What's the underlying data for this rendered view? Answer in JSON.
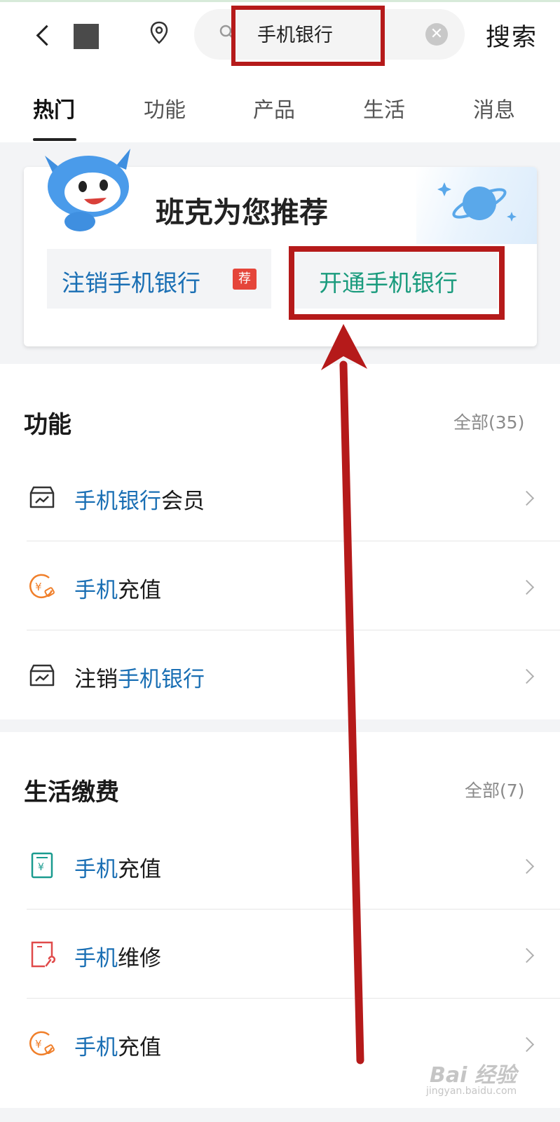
{
  "header": {
    "back_icon": "chevron-left-icon",
    "location_icon": "map-pin-icon",
    "search_icon": "search-icon",
    "search_query": "手机银行",
    "clear_icon": "clear-icon",
    "search_button": "搜索"
  },
  "tabs": [
    {
      "label": "热门",
      "active": true
    },
    {
      "label": "功能",
      "active": false
    },
    {
      "label": "产品",
      "active": false
    },
    {
      "label": "生活",
      "active": false
    },
    {
      "label": "消息",
      "active": false
    }
  ],
  "recommend": {
    "title": "班克为您推荐",
    "chips": [
      {
        "label": "注销手机银行",
        "badge": "荐"
      },
      {
        "label": "开通手机银行"
      }
    ]
  },
  "features": {
    "title": "功能",
    "all_link": "全部(35)",
    "items": [
      {
        "icon": "chart-card-icon",
        "prefix": "",
        "highlight": "手机银行",
        "suffix": "会员"
      },
      {
        "icon": "yuan-refresh-icon",
        "prefix": "",
        "highlight": "手机",
        "suffix": "充值"
      },
      {
        "icon": "chart-card-icon",
        "prefix": "注销",
        "highlight": "手机银行",
        "suffix": ""
      }
    ]
  },
  "life": {
    "title": "生活缴费",
    "all_link": "全部(7)",
    "items": [
      {
        "icon": "phone-yuan-icon",
        "prefix": "",
        "highlight": "手机",
        "suffix": "充值"
      },
      {
        "icon": "phone-wrench-icon",
        "prefix": "",
        "highlight": "手机",
        "suffix": "维修"
      },
      {
        "icon": "yuan-refresh-icon",
        "prefix": "",
        "highlight": "手机",
        "suffix": "充值"
      }
    ]
  },
  "watermark": {
    "text": "Bai 经验",
    "sub": "jingyan.baidu.com"
  },
  "colors": {
    "highlight_text": "#1a6fb4",
    "annotation_red": "#b51a1a",
    "chip2_text": "#1a9b7d",
    "badge": "#e5453a"
  }
}
